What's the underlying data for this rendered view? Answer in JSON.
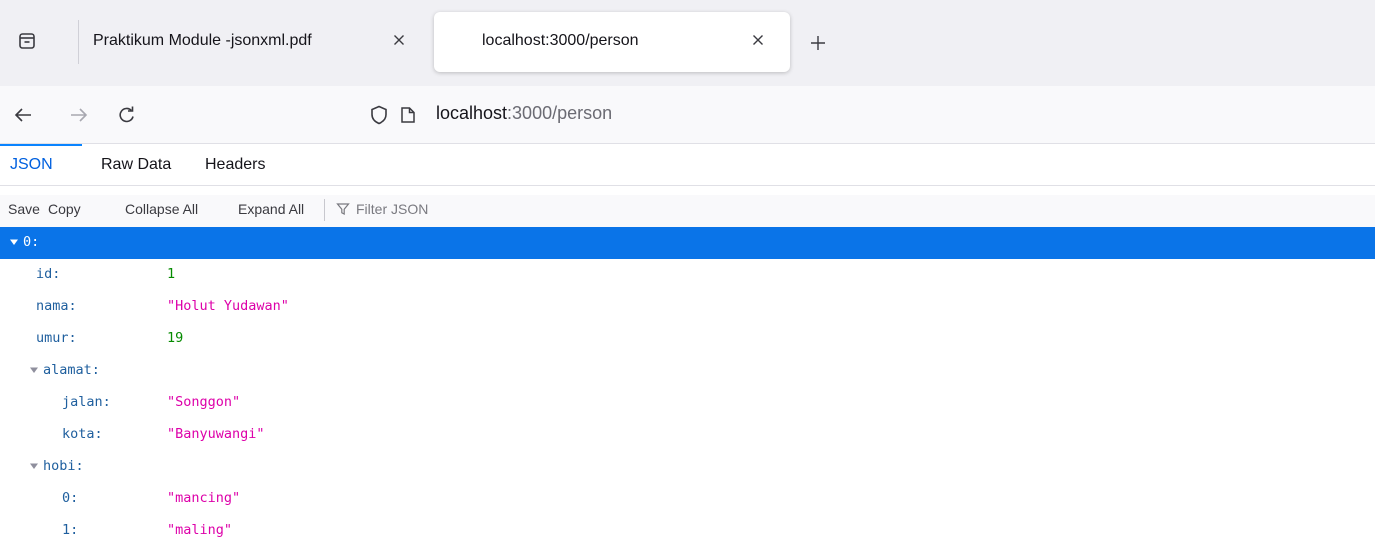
{
  "browser": {
    "tabs": [
      {
        "title": "Praktikum Module -jsonxml.pdf",
        "active": false
      },
      {
        "title": "localhost:3000/person",
        "active": true
      }
    ],
    "url": {
      "host": "localhost",
      "path": ":3000/person"
    }
  },
  "viewer": {
    "tabs": [
      "JSON",
      "Raw Data",
      "Headers"
    ],
    "selected_tab": "JSON",
    "toolbar": {
      "save": "Save",
      "copy": "Copy",
      "collapse_all": "Collapse All",
      "expand_all": "Expand All",
      "filter_placeholder": "Filter JSON"
    }
  },
  "json_tree": {
    "root": "0:",
    "id": {
      "key": "id:",
      "value": "1"
    },
    "nama": {
      "key": "nama:",
      "value": "\"Holut Yudawan\""
    },
    "umur": {
      "key": "umur:",
      "value": "19"
    },
    "alamat": {
      "key": "alamat:",
      "jalan": {
        "key": "jalan:",
        "value": "\"Songgon\""
      },
      "kota": {
        "key": "kota:",
        "value": "\"Banyuwangi\""
      }
    },
    "hobi": {
      "key": "hobi:",
      "item0": {
        "key": "0:",
        "value": "\"mancing\""
      },
      "item1": {
        "key": "1:",
        "value": "\"maling\""
      }
    }
  },
  "colors": {
    "selected_row": "#0a74e8",
    "key": "#1f5f9e",
    "string": "#dd00a9",
    "number": "#058b00",
    "tab_accent": "#0a84ff"
  }
}
